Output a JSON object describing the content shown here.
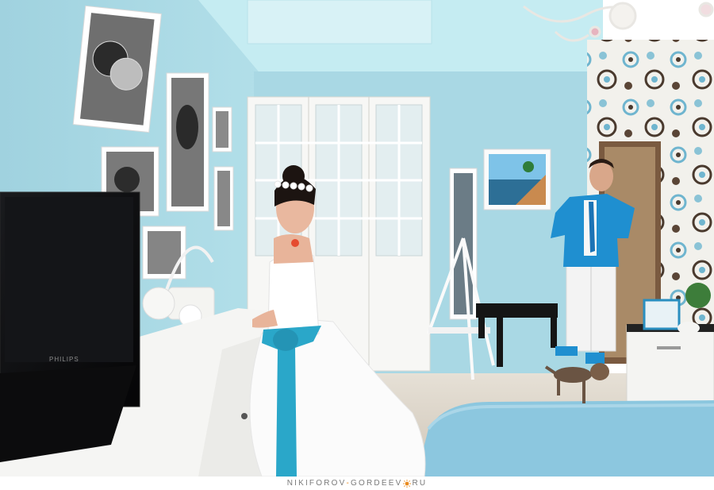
{
  "image": {
    "description_tags": [
      "bedroom",
      "bride",
      "groom",
      "wedding-dress",
      "dog"
    ]
  },
  "tv": {
    "brand": "PHILIPS"
  },
  "watermark": {
    "part1": "NIKIFOROV",
    "dash1": "-",
    "part2": "GORDEEV",
    "part3": "RU",
    "accent_color": "#e98a1e",
    "text_color": "#7a7a7a"
  },
  "palette": {
    "wall": "#a9d8e4",
    "ceiling": "#c9eef4",
    "sash": "#2aa7c9",
    "blanket": "#8cc7df",
    "jacket": "#1f8fd0"
  }
}
